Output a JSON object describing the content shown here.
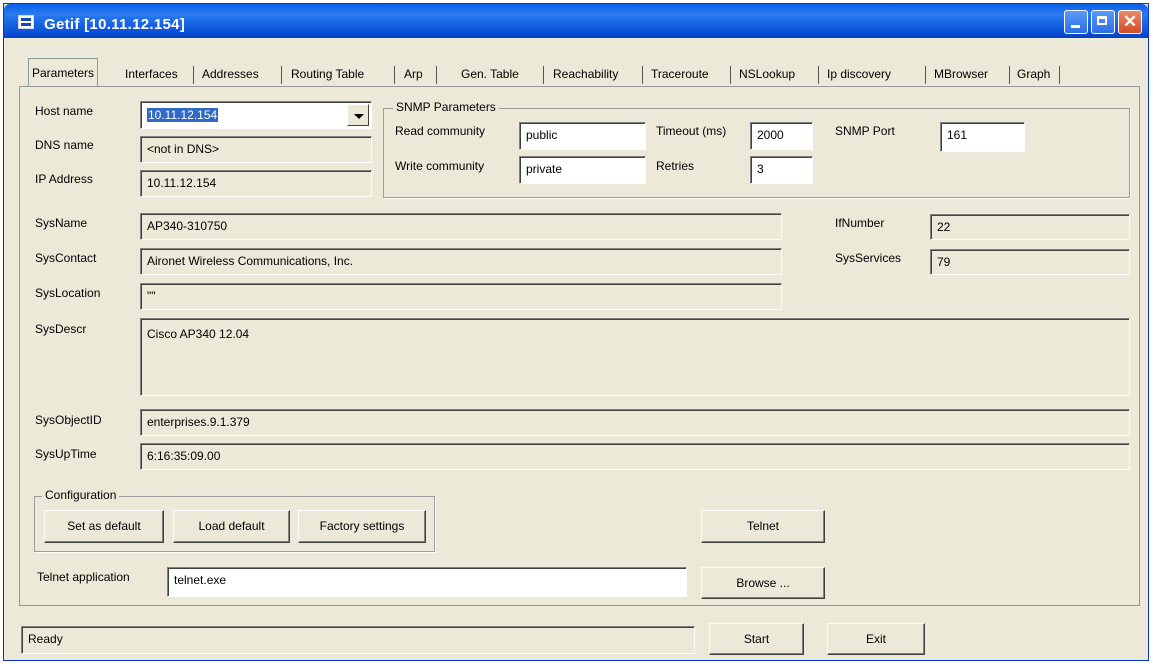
{
  "window": {
    "title": "Getif [10.11.12.154]"
  },
  "tabs": [
    "Parameters",
    "Interfaces",
    "Addresses",
    "Routing Table",
    "Arp",
    "Gen. Table",
    "Reachability",
    "Traceroute",
    "NSLookup",
    "Ip discovery",
    "MBrowser",
    "Graph"
  ],
  "active_tab": "Parameters",
  "host": {
    "host_name_label": "Host name",
    "host_name_value": "10.11.12.154",
    "dns_name_label": "DNS name",
    "dns_name_value": "<not in DNS>",
    "ip_address_label": "IP Address",
    "ip_address_value": "10.11.12.154"
  },
  "snmp": {
    "group_title": "SNMP Parameters",
    "read_community_label": "Read community",
    "read_community_value": "public",
    "write_community_label": "Write community",
    "write_community_value": "private",
    "timeout_label": "Timeout (ms)",
    "timeout_value": "2000",
    "retries_label": "Retries",
    "retries_value": "3",
    "port_label": "SNMP Port",
    "port_value": "161"
  },
  "system": {
    "sysname_label": "SysName",
    "sysname_value": "AP340-310750",
    "syscontact_label": "SysContact",
    "syscontact_value": "Aironet Wireless Communications, Inc.",
    "syslocation_label": "SysLocation",
    "syslocation_value": "\"\"",
    "sysdescr_label": "SysDescr",
    "sysdescr_value": "Cisco AP340 12.04",
    "sysobjectid_label": "SysObjectID",
    "sysobjectid_value": "enterprises.9.1.379",
    "sysuptime_label": "SysUpTime",
    "sysuptime_value": "6:16:35:09.00",
    "ifnumber_label": "IfNumber",
    "ifnumber_value": "22",
    "sysservices_label": "SysServices",
    "sysservices_value": "79"
  },
  "configuration": {
    "group_title": "Configuration",
    "set_default": "Set as default",
    "load_default": "Load default",
    "factory_settings": "Factory settings"
  },
  "telnet": {
    "button": "Telnet",
    "app_label": "Telnet application",
    "app_value": "telnet.exe",
    "browse": "Browse ..."
  },
  "footer": {
    "status": "Ready",
    "start": "Start",
    "exit": "Exit"
  }
}
